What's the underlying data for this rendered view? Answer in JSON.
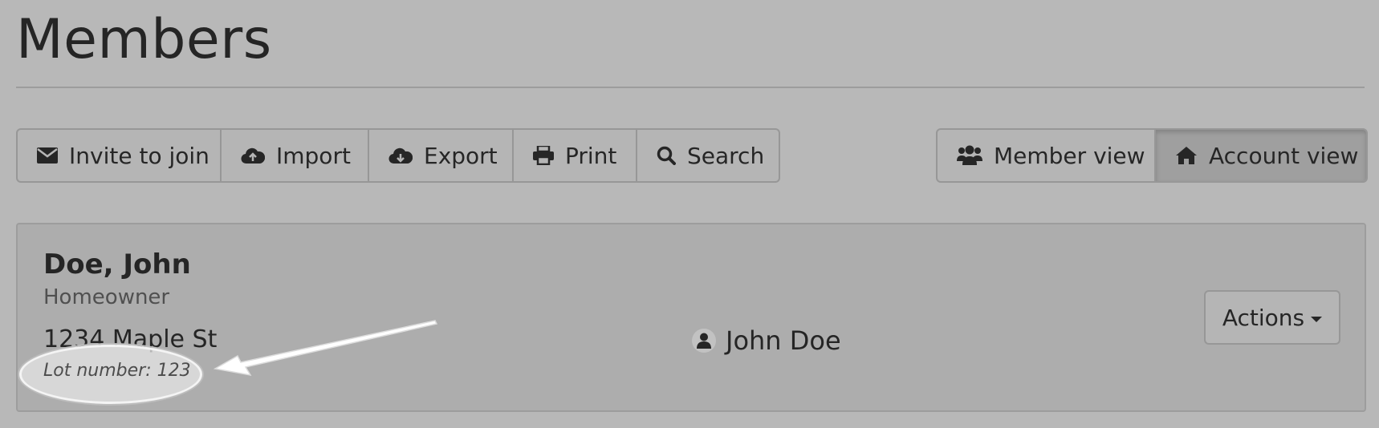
{
  "page": {
    "title": "Members"
  },
  "toolbar": {
    "invite_label": "Invite to join",
    "import_label": "Import",
    "export_label": "Export",
    "print_label": "Print",
    "search_label": "Search"
  },
  "view_toggle": {
    "member_view_label": "Member view",
    "account_view_label": "Account view",
    "active": "Account view"
  },
  "member": {
    "name": "Doe, John",
    "role": "Homeowner",
    "address": "1234 Maple St",
    "lot_number": "Lot number: 123",
    "contact_name": "John Doe",
    "actions_label": "Actions"
  },
  "icons": {
    "invite": "envelope-icon",
    "import": "cloud-upload-icon",
    "export": "cloud-download-icon",
    "print": "printer-icon",
    "search": "search-icon",
    "member_view": "users-icon",
    "account_view": "home-icon",
    "contact": "user-icon",
    "actions": "caret-down-icon"
  },
  "colors": {
    "background": "#b8b8b8",
    "card": "#adadad",
    "button_active": "#9f9f9f",
    "highlight": "#e6e6e6"
  }
}
